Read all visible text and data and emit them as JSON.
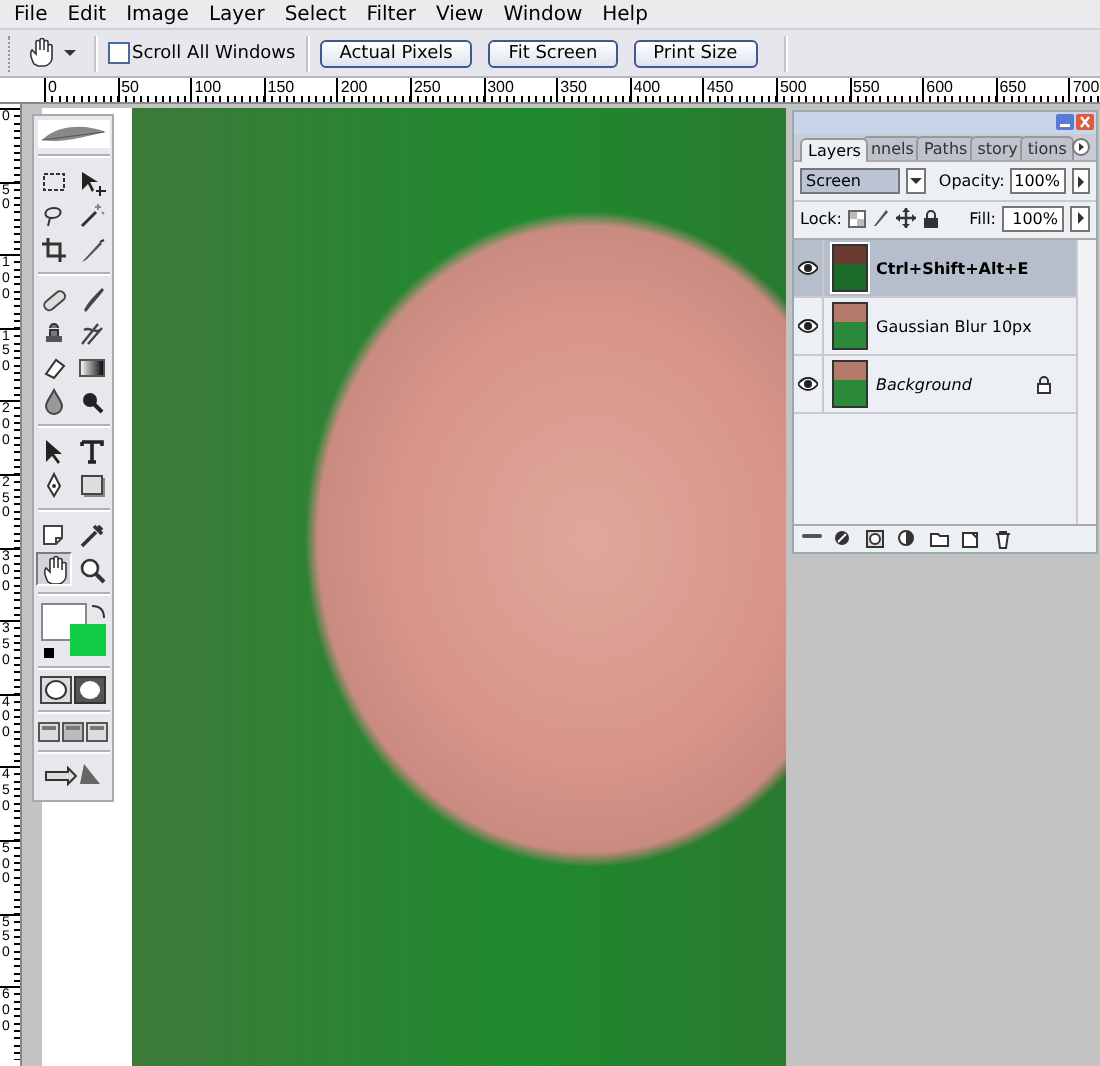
{
  "menu_bar": {
    "items": [
      "File",
      "Edit",
      "Image",
      "Layer",
      "Select",
      "Filter",
      "View",
      "Window",
      "Help"
    ]
  },
  "options_bar": {
    "scroll_all_windows": {
      "label": "Scroll All Windows",
      "checked": false
    },
    "buttons": [
      "Actual Pixels",
      "Fit Screen",
      "Print Size"
    ]
  },
  "horizontal_ruler": {
    "labels": [
      "0",
      "50",
      "100",
      "150",
      "200",
      "250",
      "300",
      "350",
      "400",
      "450",
      "500",
      "550",
      "600",
      "650",
      "700"
    ]
  },
  "vertical_ruler": {
    "labels": [
      "0",
      "50",
      "100",
      "150",
      "200",
      "250",
      "300",
      "350",
      "400",
      "450",
      "500",
      "550",
      "600"
    ]
  },
  "toolbox": {
    "tools": [
      {
        "selected": false
      },
      {
        "selected": false
      },
      {
        "selected": false
      },
      {
        "selected": false
      },
      {
        "selected": false
      },
      {
        "selected": false
      },
      {
        "selected": false
      },
      {
        "selected": false
      },
      {
        "selected": false
      },
      {
        "selected": false
      },
      {
        "selected": false
      },
      {
        "selected": false
      },
      {
        "selected": false
      },
      {
        "selected": false
      },
      {
        "selected": false
      },
      {
        "selected": false
      },
      {
        "selected": false
      },
      {
        "selected": false
      },
      {
        "selected": false
      },
      {
        "selected": false
      },
      {
        "selected": true
      },
      {
        "selected": false
      }
    ]
  },
  "layers_panel": {
    "tabs": [
      {
        "label": "Layers",
        "selected": true
      },
      {
        "label": "nnels",
        "selected": false
      },
      {
        "label": "Paths",
        "selected": false
      },
      {
        "label": "story",
        "selected": false
      },
      {
        "label": "tions",
        "selected": false
      }
    ],
    "blend_mode": "Screen",
    "opacity_label": "Opacity:",
    "opacity": "100%",
    "lock_label": "Lock:",
    "fill_label": "Fill:",
    "fill": "100%",
    "layers": [
      {
        "name": "Ctrl+Shift+Alt+E",
        "selected": true,
        "visible": true,
        "locked": false,
        "kind": "normal"
      },
      {
        "name": "Gaussian Blur 10px",
        "selected": false,
        "visible": true,
        "locked": false,
        "kind": "normal"
      },
      {
        "name": "Background",
        "selected": false,
        "visible": true,
        "locked": true,
        "kind": "background"
      }
    ]
  }
}
